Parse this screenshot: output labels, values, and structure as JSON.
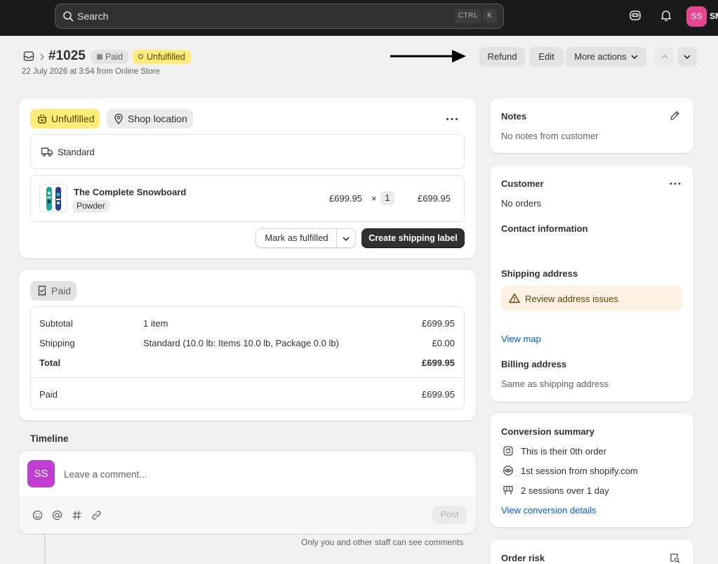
{
  "topbar": {
    "search_placeholder": "Search",
    "shortcut_ctrl": "CTRL",
    "shortcut_k": "K",
    "avatar_initials": "SS",
    "store_name_partial": "SM"
  },
  "header": {
    "order_number": "#1025",
    "badge_paid": "Paid",
    "badge_unfulfilled": "Unfulfilled",
    "date_line": "22 July 2026 at 3:54 from Online Store",
    "refund": "Refund",
    "edit": "Edit",
    "more_actions": "More actions"
  },
  "fulfillment": {
    "status": "Unfulfilled",
    "location": "Shop location",
    "shipping_method": "Standard",
    "item": {
      "name": "The Complete Snowboard",
      "variant": "Powder",
      "unit_price": "£699.95",
      "times": "×",
      "quantity": "1",
      "line_total": "£699.95"
    },
    "mark_fulfilled": "Mark as fulfilled",
    "create_label": "Create shipping label"
  },
  "payment": {
    "status": "Paid",
    "rows": [
      {
        "label": "Subtotal",
        "detail": "1 item",
        "amount": "£699.95"
      },
      {
        "label": "Shipping",
        "detail": "Standard (10.0 lb: Items 10.0 lb, Package 0.0 lb)",
        "amount": "£0.00"
      },
      {
        "label": "Total",
        "detail": "",
        "amount": "£699.95"
      }
    ],
    "paid_label": "Paid",
    "paid_amount": "£699.95"
  },
  "timeline": {
    "title": "Timeline",
    "avatar": "SS",
    "placeholder": "Leave a comment...",
    "post": "Post",
    "note": "Only you and other staff can see comments"
  },
  "notes": {
    "title": "Notes",
    "text": "No notes from customer"
  },
  "customer": {
    "title": "Customer",
    "orders": "No orders",
    "contact_title": "Contact information",
    "shipping_title": "Shipping address",
    "warning": "Review address issues",
    "view_map": "View map",
    "billing_title": "Billing address",
    "billing_text": "Same as shipping address"
  },
  "conversion": {
    "title": "Conversion summary",
    "rows": [
      {
        "icon": "order-repeat-icon",
        "text": "This is their 0th order"
      },
      {
        "icon": "eye-icon",
        "text": "1st session from shopify.com"
      },
      {
        "icon": "store-icon",
        "text": "2 sessions over 1 day"
      }
    ],
    "link": "View conversion details"
  },
  "risk": {
    "title": "Order risk"
  },
  "colors": {
    "topbar": "#1a1a1a",
    "unfulfilled_badge": "#ffeb78",
    "primary_button": "#303030",
    "link": "#005bd3",
    "warning_bg": "#fff1e3",
    "avatar_pink": "#e6468f",
    "avatar_purple": "#c13cd1"
  }
}
